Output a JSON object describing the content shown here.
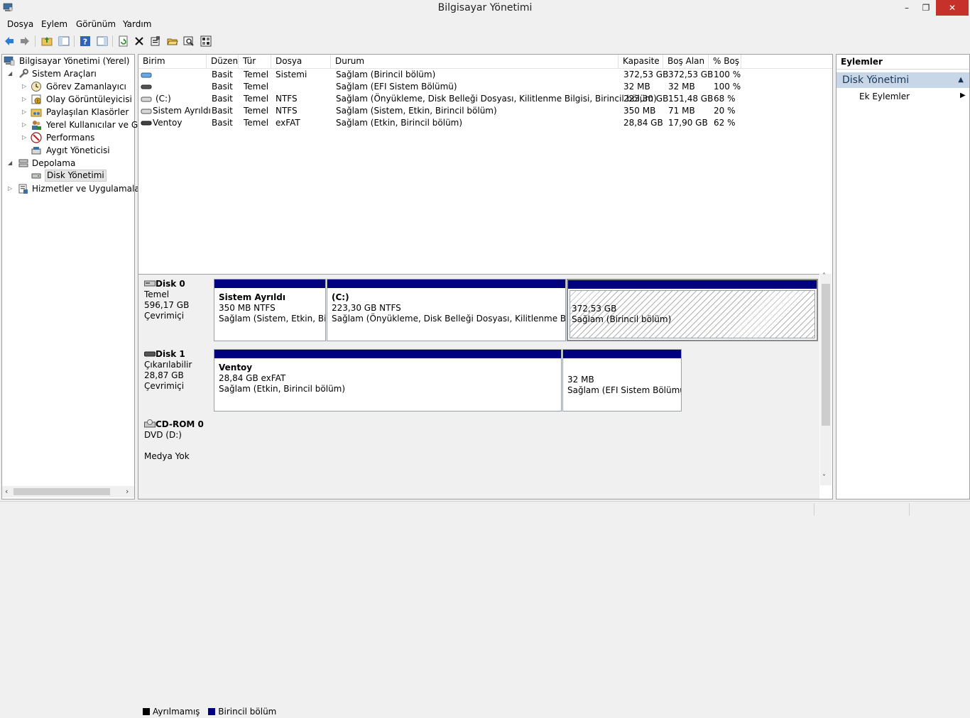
{
  "window": {
    "title": "Bilgisayar Yönetimi",
    "minimize_glyph": "–",
    "maximize_glyph": "❐",
    "close_glyph": "✕"
  },
  "menu": [
    "Dosya",
    "Eylem",
    "Görünüm",
    "Yardım"
  ],
  "toolbar": {
    "icons": [
      "back-icon",
      "forward-icon",
      "up-folder-icon",
      "show-hide-tree-icon",
      "help-icon",
      "show-hide-action-pane-icon",
      "refresh-icon",
      "delete-icon",
      "properties-icon",
      "open-icon",
      "search-icon",
      "settings-icon"
    ]
  },
  "tree": {
    "root": "Bilgisayar Yönetimi (Yerel)",
    "system_tools": "Sistem Araçları",
    "task_scheduler": "Görev Zamanlayıcı",
    "event_viewer": "Olay Görüntüleyicisi",
    "shared_folders": "Paylaşılan Klasörler",
    "local_users": "Yerel Kullanıcılar ve Gru",
    "performance": "Performans",
    "device_manager": "Aygıt Yöneticisi",
    "storage": "Depolama",
    "disk_management": "Disk Yönetimi",
    "services_apps": "Hizmetler ve Uygulamalar"
  },
  "volume_list": {
    "columns": [
      "Birim",
      "Düzen",
      "Tür",
      "Dosya Sistemi",
      "Durum",
      "Kapasite",
      "Boş Alan",
      "% Boş"
    ],
    "rows": [
      {
        "birim": "",
        "duzen": "Basit",
        "tur": "Temel",
        "fs": "",
        "durum": "Sağlam (Birincil bölüm)",
        "kapasite": "372,53 GB",
        "bos": "372,53 GB",
        "yuzde": "100 %"
      },
      {
        "birim": "",
        "duzen": "Basit",
        "tur": "Temel",
        "fs": "",
        "durum": "Sağlam (EFI Sistem Bölümü)",
        "kapasite": "32 MB",
        "bos": "32 MB",
        "yuzde": "100 %"
      },
      {
        "birim": "(C:)",
        "duzen": "Basit",
        "tur": "Temel",
        "fs": "NTFS",
        "durum": "Sağlam (Önyükleme, Disk Belleği Dosyası, Kilitlenme Bilgisi, Birincil bölüm)",
        "kapasite": "223,30 GB",
        "bos": "151,48 GB",
        "yuzde": "68 %"
      },
      {
        "birim": "Sistem Ayrıldı",
        "duzen": "Basit",
        "tur": "Temel",
        "fs": "NTFS",
        "durum": "Sağlam (Sistem, Etkin, Birincil bölüm)",
        "kapasite": "350 MB",
        "bos": "71 MB",
        "yuzde": "20 %"
      },
      {
        "birim": "Ventoy",
        "duzen": "Basit",
        "tur": "Temel",
        "fs": "exFAT",
        "durum": "Sağlam (Etkin, Birincil bölüm)",
        "kapasite": "28,84 GB",
        "bos": "17,90 GB",
        "yuzde": "62 %"
      }
    ]
  },
  "disks": [
    {
      "name": "Disk 0",
      "type": "Temel",
      "size": "596,17 GB",
      "state": "Çevrimiçi",
      "partitions": [
        {
          "title": "Sistem Ayrıldı",
          "line2": "350 MB NTFS",
          "line3": "Sağlam (Sistem, Etkin, Birin"
        },
        {
          "title": "(C:)",
          "line2": "223,30 GB NTFS",
          "line3": "Sağlam (Önyükleme, Disk Belleği Dosyası, Kilitlenme Bilgisi, B"
        },
        {
          "title": "",
          "line2": "372,53 GB",
          "line3": "Sağlam (Birincil bölüm)"
        }
      ]
    },
    {
      "name": "Disk 1",
      "type": "Çıkarılabilir",
      "size": "28,87 GB",
      "state": "Çevrimiçi",
      "partitions": [
        {
          "title": "Ventoy",
          "line2": "28,84 GB exFAT",
          "line3": "Sağlam (Etkin, Birincil bölüm)"
        },
        {
          "title": "",
          "line2": "32 MB",
          "line3": "Sağlam (EFI Sistem Bölümü)"
        }
      ]
    },
    {
      "name": "CD-ROM 0",
      "type": "DVD (D:)",
      "size": "",
      "state": "Medya Yok",
      "partitions": []
    }
  ],
  "legend": {
    "unallocated": "Ayrılmamış",
    "primary": "Birincil bölüm",
    "unallocated_color": "#000000",
    "primary_color": "#000080"
  },
  "actions": {
    "header": "Eylemler",
    "section": "Disk Yönetimi",
    "more": "Ek Eylemler"
  }
}
